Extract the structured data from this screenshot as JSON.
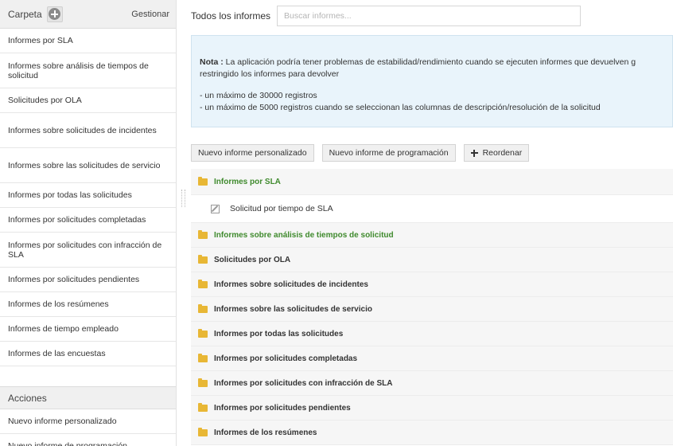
{
  "sidebar": {
    "folder_header": {
      "title": "Carpeta",
      "manage_label": "Gestionar"
    },
    "folders": [
      "Informes por SLA",
      "Informes sobre análisis de tiempos de solicitud",
      "Solicitudes por OLA",
      "Informes sobre solicitudes de incidentes",
      "Informes sobre las solicitudes de servicio",
      "Informes por todas las solicitudes",
      "Informes por solicitudes completadas",
      "Informes por solicitudes con infracción de SLA",
      "Informes por solicitudes pendientes",
      "Informes de los resúmenes",
      "Informes de tiempo empleado",
      "Informes de las encuestas"
    ],
    "actions_header": "Acciones",
    "actions": [
      "Nuevo informe personalizado",
      "Nuevo informe de programación"
    ]
  },
  "main": {
    "title": "Todos los informes",
    "search_placeholder": "Buscar informes...",
    "note": {
      "label": "Nota :",
      "line1": "La aplicación podría tener problemas de estabilidad/rendimiento cuando se ejecuten informes que devuelven g",
      "line2": "restringido los informes para devolver",
      "bullet1": "- un máximo de 30000 registros",
      "bullet2": "- un máximo de 5000 registros cuando se seleccionan las columnas de descripción/resolución de la solicitud"
    },
    "buttons": {
      "custom": "Nuevo informe personalizado",
      "schedule": "Nuevo informe de programación",
      "reorder": "Reordenar"
    },
    "tree": [
      {
        "type": "folder",
        "label": "Informes por SLA",
        "open": true,
        "green": true
      },
      {
        "type": "report",
        "label": "Solicitud por tiempo de SLA"
      },
      {
        "type": "folder",
        "label": "Informes sobre análisis de tiempos de solicitud",
        "green": true
      },
      {
        "type": "folder",
        "label": "Solicitudes por OLA"
      },
      {
        "type": "folder",
        "label": "Informes sobre solicitudes de incidentes"
      },
      {
        "type": "folder",
        "label": "Informes sobre las solicitudes de servicio"
      },
      {
        "type": "folder",
        "label": "Informes por todas las solicitudes"
      },
      {
        "type": "folder",
        "label": "Informes por solicitudes completadas"
      },
      {
        "type": "folder",
        "label": "Informes por solicitudes con infracción de SLA"
      },
      {
        "type": "folder",
        "label": "Informes por solicitudes pendientes"
      },
      {
        "type": "folder",
        "label": "Informes de los resúmenes"
      }
    ]
  },
  "colors": {
    "accent_green": "#3f8a2d",
    "note_background": "#e9f4fb",
    "folder_icon": "#e8b735"
  }
}
